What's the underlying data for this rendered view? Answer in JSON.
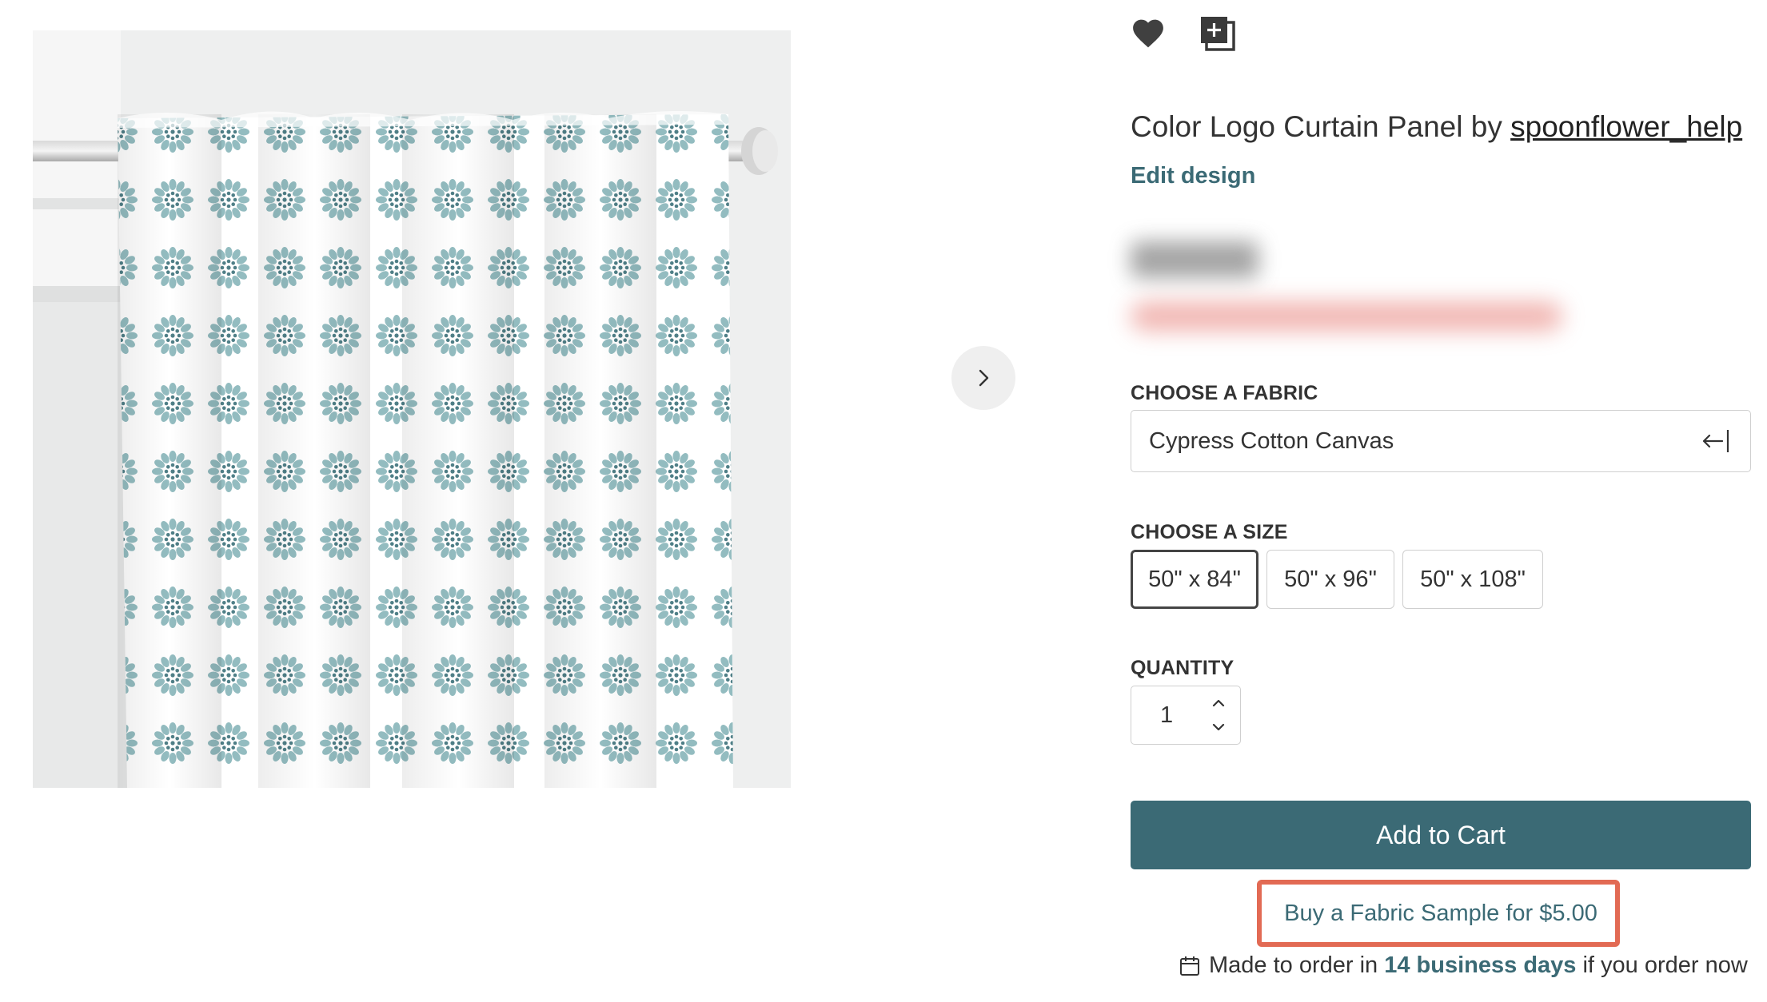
{
  "product": {
    "title_prefix": "Color Logo Curtain Panel by ",
    "designer": "spoonflower_help",
    "edit_label": "Edit design"
  },
  "icons": {
    "favorite": "heart-icon",
    "add_to_collection": "add-to-collection-icon",
    "next_image": "chevron-right-icon",
    "fabric_select": "arrow-left-bar-icon",
    "quantity_up": "chevron-up-icon",
    "quantity_down": "chevron-down-icon",
    "shipping": "calendar-icon"
  },
  "fabric": {
    "label": "CHOOSE A FABRIC",
    "value": "Cypress Cotton Canvas"
  },
  "size": {
    "label": "CHOOSE A SIZE",
    "options": [
      "50\" x 84\"",
      "50\" x 96\"",
      "50\" x 108\""
    ],
    "selected": "50\" x 84\""
  },
  "quantity": {
    "label": "QUANTITY",
    "value": "1"
  },
  "actions": {
    "add_to_cart": "Add to Cart",
    "sample": "Buy a Fabric Sample for $5.00"
  },
  "shipping": {
    "prefix": "Made to order in ",
    "days": "14 business days",
    "suffix": " if you order now"
  },
  "colors": {
    "accent": "#3b6a75",
    "highlight": "#e26a54",
    "pattern_light": "#93bcc0",
    "pattern_dark": "#4f7f87"
  }
}
